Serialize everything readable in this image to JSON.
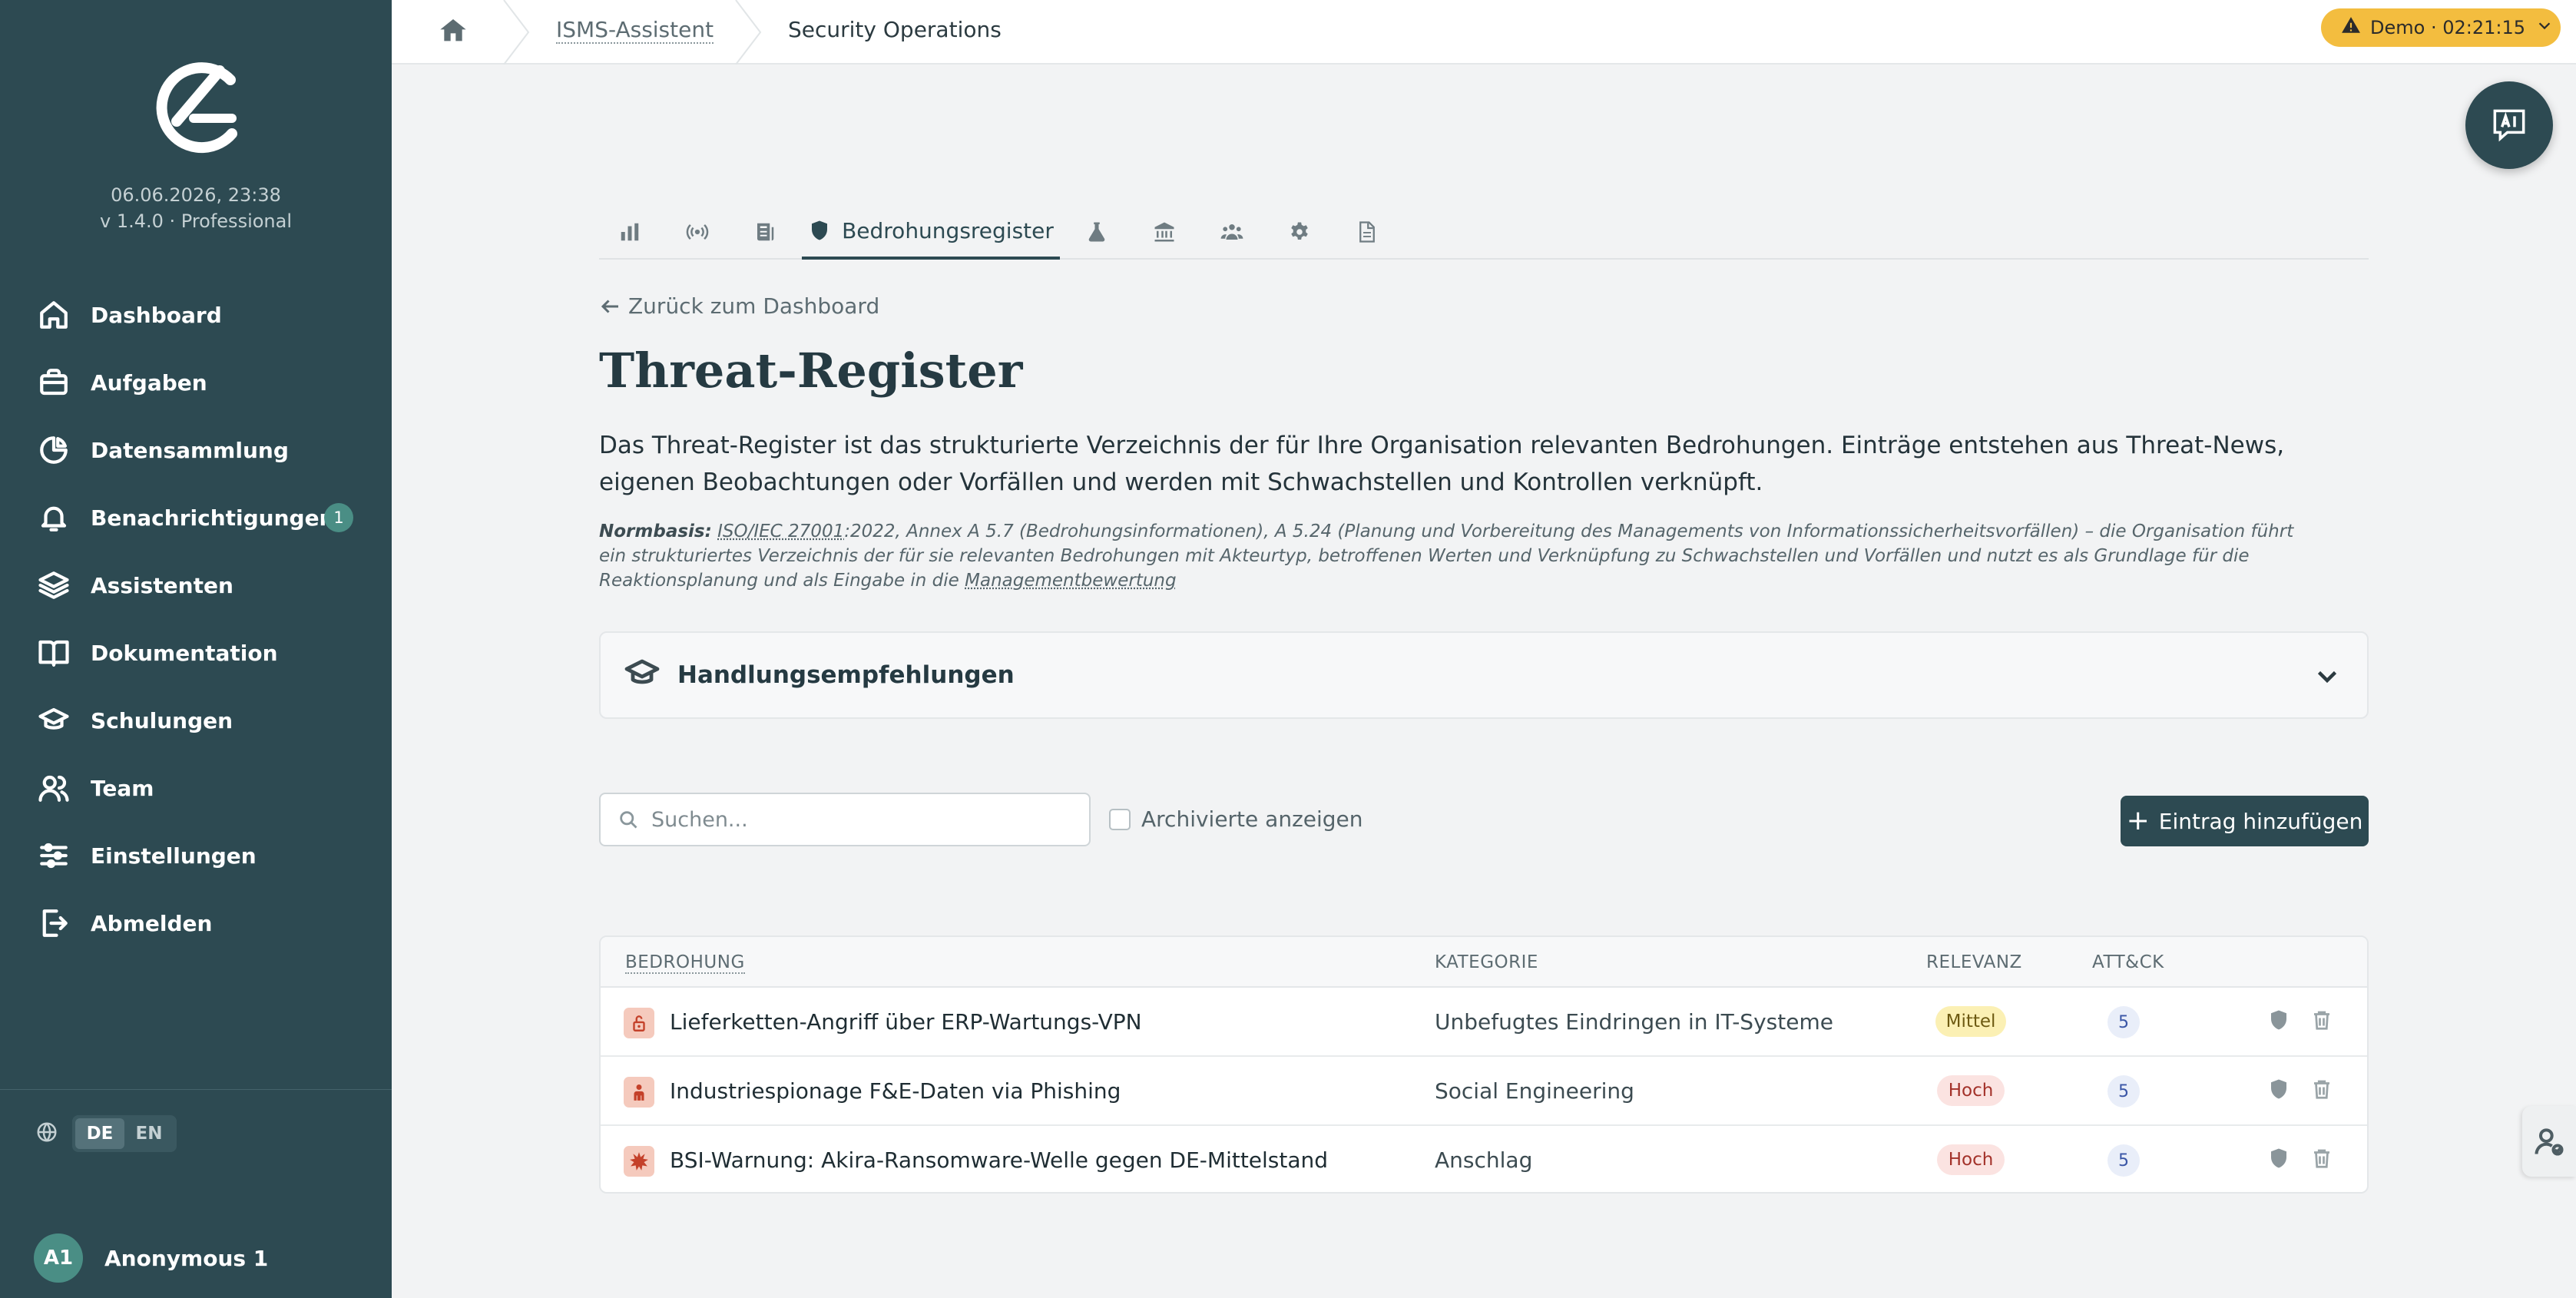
{
  "sidebar": {
    "date": "06.06.2026, 23:38",
    "version": "v 1.4.0 · Professional",
    "items": [
      {
        "label": "Dashboard",
        "icon": "home-icon"
      },
      {
        "label": "Aufgaben",
        "icon": "briefcase-icon"
      },
      {
        "label": "Datensammlung",
        "icon": "pie-chart-icon"
      },
      {
        "label": "Benachrichtigungen",
        "icon": "bell-icon",
        "badge": "1"
      },
      {
        "label": "Assistenten",
        "icon": "layers-icon"
      },
      {
        "label": "Dokumentation",
        "icon": "book-icon"
      },
      {
        "label": "Schulungen",
        "icon": "graduation-cap-icon"
      },
      {
        "label": "Team",
        "icon": "users-icon"
      },
      {
        "label": "Einstellungen",
        "icon": "sliders-icon"
      },
      {
        "label": "Abmelden",
        "icon": "logout-icon"
      }
    ],
    "languages": [
      "DE",
      "EN"
    ],
    "active_language": "DE",
    "user": {
      "initials": "A1",
      "name": "Anonymous 1"
    }
  },
  "topbar": {
    "breadcrumbs": [
      "ISMS-Assistent",
      "Security Operations"
    ],
    "demo_badge": "Demo · 02:21:15"
  },
  "tabs": [
    {
      "icon": "bar-chart-icon",
      "label": ""
    },
    {
      "icon": "broadcast-icon",
      "label": ""
    },
    {
      "icon": "news-icon",
      "label": ""
    },
    {
      "icon": "shield-icon",
      "label": "Bedrohungsregister",
      "active": true
    },
    {
      "icon": "flask-icon",
      "label": ""
    },
    {
      "icon": "bank-icon",
      "label": ""
    },
    {
      "icon": "group-icon",
      "label": ""
    },
    {
      "icon": "gear-icon",
      "label": ""
    },
    {
      "icon": "document-icon",
      "label": ""
    }
  ],
  "page": {
    "back_link": "Zurück zum Dashboard",
    "title": "Threat-Register",
    "description": "Das Threat-Register ist das strukturierte Verzeichnis der für Ihre Organisation relevanten Bedrohungen. Einträge entstehen aus Threat-News, eigenen Beobachtungen oder Vorfällen und werden mit Schwachstellen und Kontrollen verknüpft.",
    "norm_label": "Normbasis:",
    "norm_link1": "ISO/IEC 27001",
    "norm_text": ":2022, Annex A 5.7 (Bedrohungsinformationen), A 5.24 (Planung und Vorbereitung des Managements von Informationssicherheitsvorfällen) – die Organisation führt ein strukturiertes Verzeichnis der für sie relevanten Bedrohungen mit Akteurtyp, betroffenen Werten und Verknüpfung zu Schwachstellen und Vorfällen und nutzt es als Grundlage für die Reaktionsplanung und als Eingabe in die ",
    "norm_link2": "Managementbewertung",
    "accordion_title": "Handlungsempfehlungen"
  },
  "toolbar": {
    "search_placeholder": "Suchen...",
    "archive_label": "Archivierte anzeigen",
    "add_label": "Eintrag hinzufügen"
  },
  "table": {
    "headers": {
      "threat": "BEDROHUNG",
      "category": "KATEGORIE",
      "relevance": "RELEVANZ",
      "attck": "ATT&CK"
    },
    "rows": [
      {
        "icon": "lock-open-icon",
        "name": "Lieferketten-Angriff über ERP-Wartungs-VPN",
        "category": "Unbefugtes Eindringen in IT-Systeme",
        "relevance": "Mittel",
        "attck": "5"
      },
      {
        "icon": "spy-icon",
        "name": "Industriespionage F&E-Daten via Phishing",
        "category": "Social Engineering",
        "relevance": "Hoch",
        "attck": "5"
      },
      {
        "icon": "explosion-icon",
        "name": "BSI-Warnung: Akira-Ransomware-Welle gegen DE-Mittelstand",
        "category": "Anschlag",
        "relevance": "Hoch",
        "attck": "5"
      }
    ]
  },
  "colors": {
    "sidebar_bg": "#2d4a52",
    "accent": "#4a8e85",
    "demo_badge": "#f3bd3f",
    "relevance_mittel": "#fbf0b4",
    "relevance_hoch": "#fbe3e1"
  }
}
